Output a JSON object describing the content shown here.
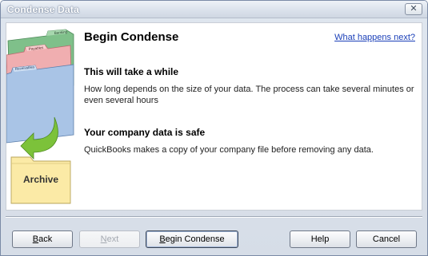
{
  "window": {
    "title": "Condense Data",
    "close_glyph": "✕"
  },
  "illustration": {
    "folder_labels": [
      "Banking",
      "Payables",
      "Receivables"
    ],
    "archive_label": "Archive",
    "colors": {
      "green_folder": "#7fc08a",
      "pink_folder": "#f0aeb0",
      "blue_folder": "#a9c4e6",
      "arrow": "#7cc23a",
      "archive_folder": "#fbeaa6"
    }
  },
  "main": {
    "heading": "Begin Condense",
    "help_link": "What happens next?",
    "sections": [
      {
        "title": "This will take a while",
        "body": "How long depends on the size of your data. The process can take several minutes or even several hours"
      },
      {
        "title": "Your company data is safe",
        "body": "QuickBooks makes a copy of your company file before removing any data."
      }
    ]
  },
  "buttons": {
    "back": {
      "label": "Back",
      "mnemonic": "B",
      "rest": "ack"
    },
    "next": {
      "label": "Next",
      "mnemonic": "N",
      "rest": "ext"
    },
    "begin": {
      "label": "Begin Condense",
      "mnemonic": "B",
      "rest": "egin Condense"
    },
    "help": {
      "label": "Help"
    },
    "cancel": {
      "label": "Cancel"
    }
  }
}
